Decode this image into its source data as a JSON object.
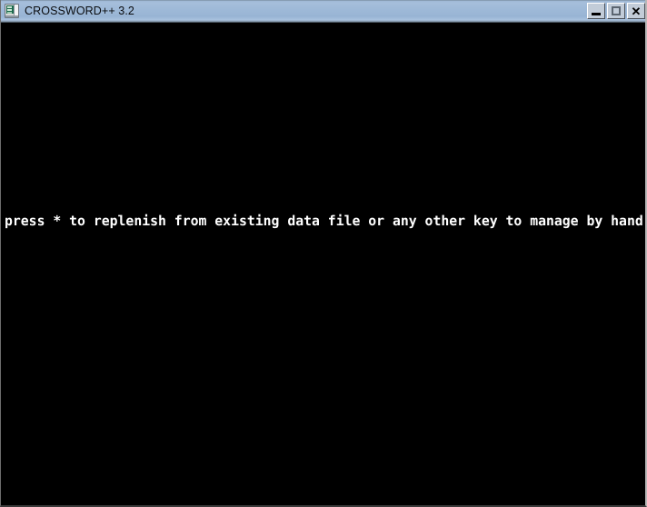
{
  "window": {
    "title": "CROSSWORD++ 3.2",
    "icon": "console-window-icon",
    "background_color": "#000000",
    "titlebar_color": "#9db8d7",
    "titlebar_text_color": "#0b0d10"
  },
  "titlebar_buttons": {
    "minimize_label": "",
    "maximize_label": "",
    "close_label": "✕",
    "minimize_name": "minimize-button",
    "maximize_name": "maximize-button",
    "close_name": "close-button"
  },
  "console": {
    "text_color": "#ffffff",
    "prompt_line": "press * to replenish from existing data file or any other key to manage by hand"
  }
}
